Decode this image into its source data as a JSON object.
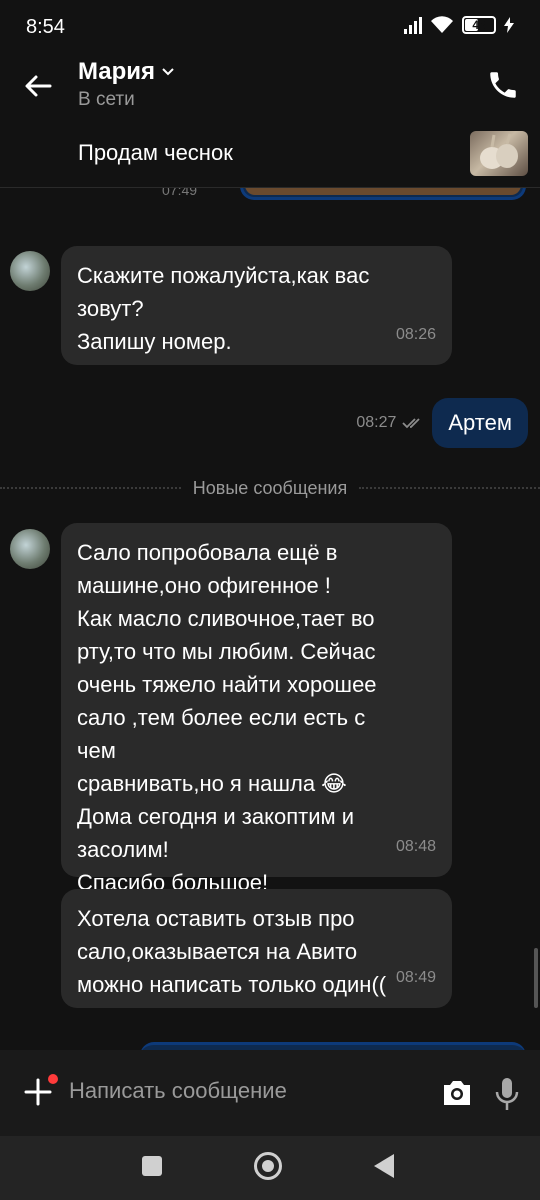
{
  "status_bar": {
    "time": "8:54",
    "battery": "45",
    "battery_level": 0.45
  },
  "header": {
    "contact_name": "Мария",
    "contact_status": "В сети"
  },
  "listing": {
    "title": "Продам чеснок"
  },
  "messages": {
    "partial_top": {
      "time": "07:49"
    },
    "m1": {
      "text": "Скажите пожалуйста,как вас\nзовут?\nЗапишу номер.",
      "time": "08:26"
    },
    "m2": {
      "text": "Артем",
      "time": "08:27"
    },
    "divider": "Новые сообщения",
    "m3": {
      "text": "Сало попробовала ещё в\nмашине,оно офигенное !\nКак масло сливочное,тает во\nрту,то что мы любим. Сейчас\nочень тяжело найти хорошее\nсало ,тем более если есть с чем\nсравнивать,но я нашла 😂\nДома сегодня и закоптим и\nзасолим!\nСпасибо большое!",
      "time": "08:48"
    },
    "m4": {
      "text": "Хотела оставить отзыв про\nсало,оказывается на Авито\nможно написать только один((",
      "time": "08:49"
    }
  },
  "composer": {
    "placeholder": "Написать сообщение"
  },
  "colors": {
    "accent_dark_blue": "#0e2a4f",
    "incoming_bubble": "#2a2a2a",
    "background": "#121212"
  }
}
